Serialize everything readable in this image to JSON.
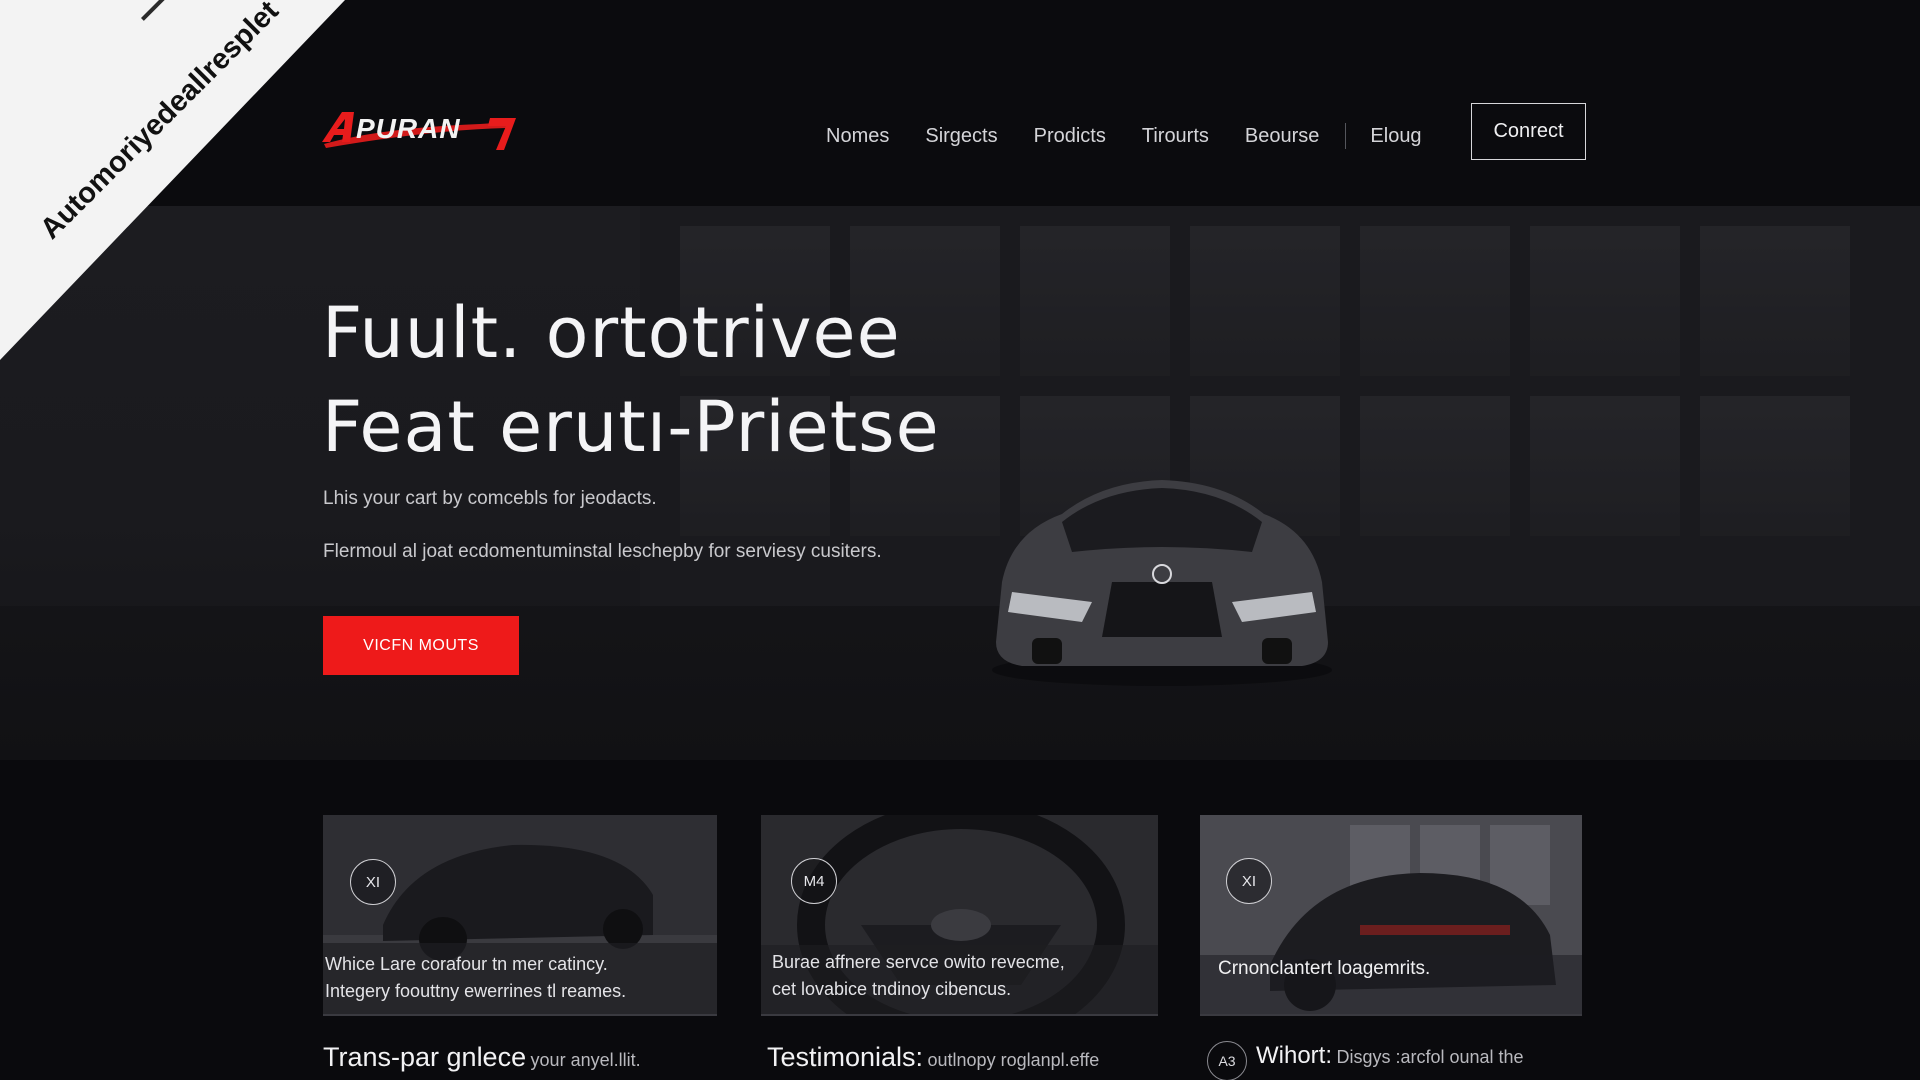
{
  "ribbon": {
    "text": "Automoriyedeallresplet"
  },
  "header": {
    "logo_text": "APURAN",
    "nav": [
      "Nomes",
      "Sirgects",
      "Prodicts",
      "Tirourts",
      "Beourse",
      "Eloug"
    ],
    "connect_label": "Conrect"
  },
  "hero": {
    "title_line1": "Fuult. ortotrivee",
    "title_line2": "Feat erutı-Prietse",
    "subtitle1": "Lhis your cart by comcebls for jeodacts.",
    "subtitle2": "Flermoul al joat ecdomentuminstal leschepby for serviesy cusiters.",
    "cta_label": "VICFN MOUTS"
  },
  "cards": [
    {
      "badge": "XI",
      "text_line1": "Whice Lare corafour tn mer catincy.",
      "text_line2": "Integery foouttny ewerrines tl reames."
    },
    {
      "badge": "M4",
      "text_line1": "Burae affnere servce owito revecme,",
      "text_line2": "cet lovabice tndinoy cibencus."
    },
    {
      "badge": "XI",
      "caption": "Crnonclantert loagemrits."
    }
  ],
  "sections": [
    {
      "title": "Trans-par gnlece",
      "subtitle": "your anyel.llit."
    },
    {
      "title": "Testimonials:",
      "subtitle": "outlnopy roglanpl.effe"
    },
    {
      "badge": "A3",
      "title": "Wihort:",
      "subtitle": "Disgys :arcfol ounal the"
    }
  ],
  "colors": {
    "accent": "#ee1a1a",
    "background": "#0a0a0d",
    "hero_background": "#1c1c20",
    "text": "#e8e8ea"
  }
}
